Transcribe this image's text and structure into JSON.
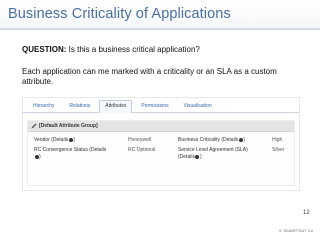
{
  "slide": {
    "title": "Business Criticality of Applications",
    "question_label": "QUESTION:",
    "question_text": " Is this a business critical application?",
    "description": "Each application can me marked with a criticality or an SLA as a custom attribute.",
    "page_number": "12",
    "logo_text": "© SMARTSAT Co"
  },
  "panel": {
    "tabs": [
      {
        "label": "Hierarchy",
        "active": false
      },
      {
        "label": "Relations",
        "active": false
      },
      {
        "label": "Attributes",
        "active": true
      },
      {
        "label": "Permissions",
        "active": false
      },
      {
        "label": "Visualisation",
        "active": false
      }
    ],
    "group_title": "[Default Attribute Group]",
    "attributes": [
      {
        "label_a": "Vendor (Details",
        "label_b": ")",
        "value": "Honeywell"
      },
      {
        "label_a": "RC Convergence Status (Details",
        "label_b": ")",
        "value": "RC Optional"
      },
      {
        "label_a": "Business Criticality (Details",
        "label_b": ")",
        "value": "High"
      },
      {
        "label_a": "Service Level Agreement (SLA)",
        "label_b": "(Details",
        "label_c": ")",
        "value": "Silver"
      }
    ]
  }
}
